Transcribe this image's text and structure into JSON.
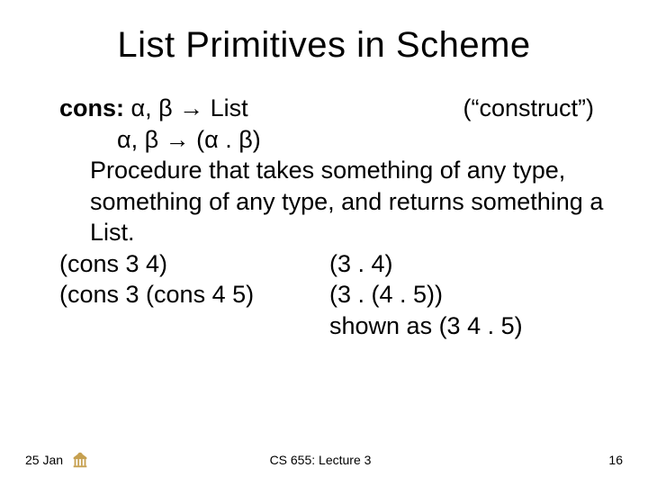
{
  "title": "List Primitives in Scheme",
  "line1": {
    "label": "cons:",
    "sig": " α, β → List",
    "note": "(“construct”)"
  },
  "line2": "α, β → (α . β)",
  "desc": "Procedure that takes something of any type, something of any type, and returns something a List.",
  "ex1": {
    "call": "(cons 3 4)",
    "result": "(3 . 4)"
  },
  "ex2": {
    "call": "(cons 3 (cons 4 5)",
    "result": "(3 . (4 . 5))"
  },
  "shown": "shown as (3 4 . 5)",
  "footer": {
    "date": "25 Jan",
    "center": "CS 655: Lecture 3",
    "page": "16"
  }
}
